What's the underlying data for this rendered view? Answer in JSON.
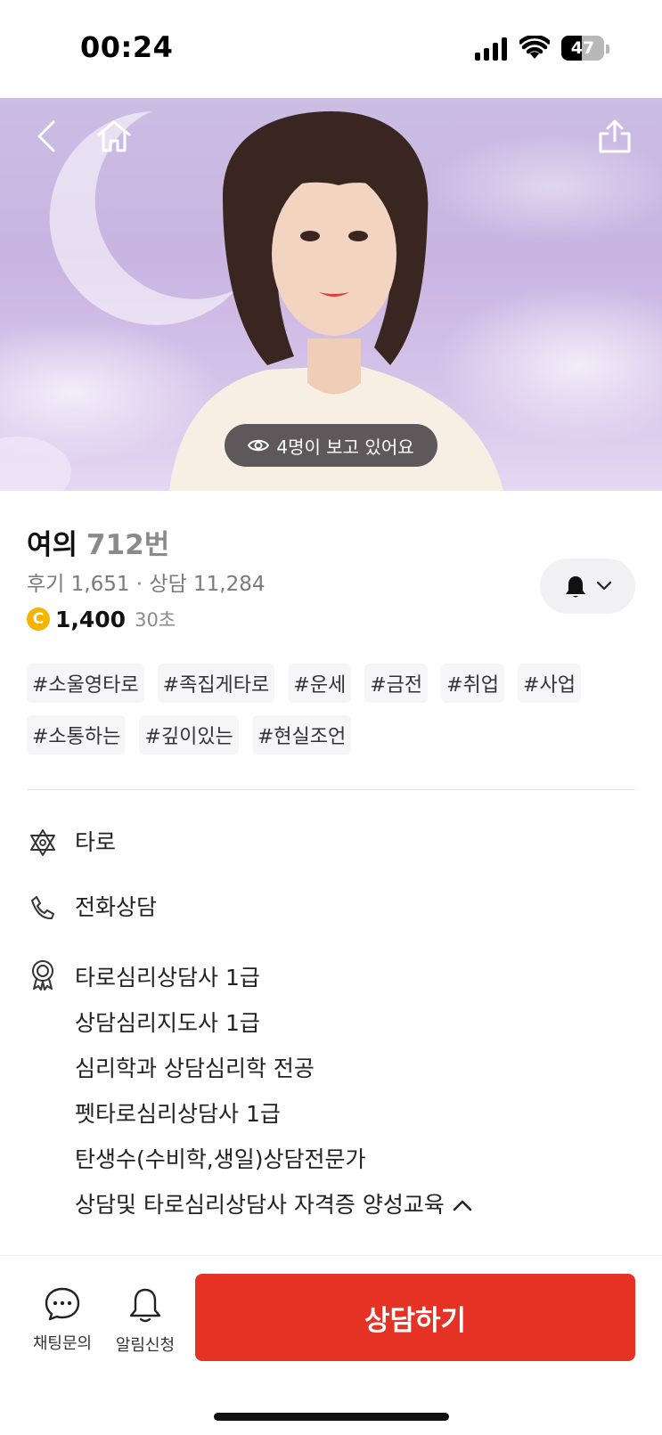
{
  "status_bar": {
    "time": "00:24",
    "battery": "47",
    "battery_level": 0.47
  },
  "hero": {
    "viewers_text": "4명이 보고 있어요",
    "icons": {
      "back": "back-arrow-icon",
      "home": "home-icon",
      "share": "share-icon",
      "eye": "eye-icon"
    }
  },
  "profile": {
    "name": "여의",
    "number": "712번",
    "stats": "후기 1,651 · 상담 11,284",
    "price": "1,400",
    "price_unit": "30초",
    "coin_symbol": "C"
  },
  "tags": [
    "#소울영타로",
    "#족집게타로",
    "#운세",
    "#금전",
    "#취업",
    "#사업",
    "#소통하는",
    "#깊이있는",
    "#현실조언"
  ],
  "info": {
    "category": "타로",
    "method": "전화상담",
    "qualifications": [
      "타로심리상담사 1급",
      "상담심리지도사 1급",
      "심리학과 상담심리학 전공",
      "펫타로심리상담사 1급",
      "탄생수(수비학,생일)상담전문가",
      "상담및 타로심리상담사 자격증 양성교육"
    ]
  },
  "bottom_bar": {
    "chat_label": "채팅문의",
    "alert_label": "알림신청",
    "consult_label": "상담하기"
  },
  "colors": {
    "accent": "#e53224",
    "coin": "#f5b400",
    "hero_bg": "#cbbde4"
  }
}
